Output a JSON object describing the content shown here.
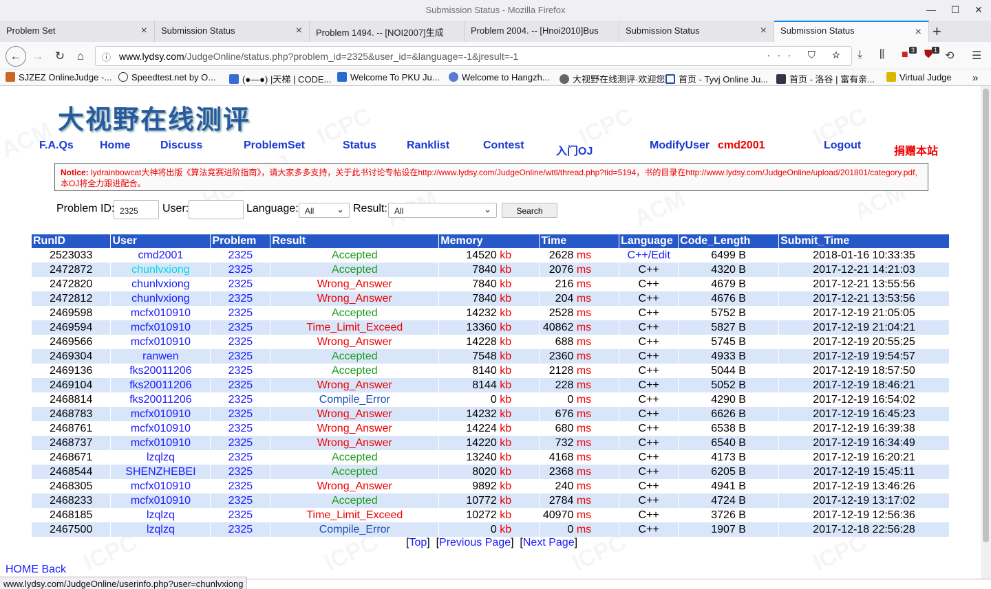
{
  "window": {
    "title": "Submission Status - Mozilla Firefox",
    "minimize": "—",
    "maximize": "☐",
    "close": "✕"
  },
  "tabs": [
    {
      "label": "Problem Set"
    },
    {
      "label": "Submission Status"
    },
    {
      "label": "Problem 1494. -- [NOI2007]生成"
    },
    {
      "label": "Problem 2004. -- [Hnoi2010]Bus"
    },
    {
      "label": "Submission Status"
    },
    {
      "label": "Submission Status"
    }
  ],
  "toolbar": {
    "url_host": "www.lydsy.com",
    "url_path": "/JudgeOnline/status.php?problem_id=2325&user_id=&language=-1&jresult=-1",
    "url_actions": "··· ⛉ ☆",
    "badge_addon1": "3",
    "badge_addon2": "1"
  },
  "bookmarks": [
    {
      "label": "SJZEZ OnlineJudge -...",
      "color": "#c62"
    },
    {
      "label": "Speedtest.net by O...",
      "color": "#333"
    },
    {
      "label": "(●—●) |天梯 | CODE...",
      "color": "#3a6bd1"
    },
    {
      "label": "Welcome To PKU Ju...",
      "color": "#2a6bd1"
    },
    {
      "label": "Welcome to Hangzh...",
      "color": "#5a7ad1"
    },
    {
      "label": "大视野在线测评·欢迎您",
      "color": "#666"
    },
    {
      "label": "首页 - Tyvj Online Ju...",
      "color": "#2a4a9a"
    },
    {
      "label": "首页 - 洛谷 | 富有亲...",
      "color": "#334"
    },
    {
      "label": "Virtual Judge",
      "color": "#d8b800"
    }
  ],
  "site": {
    "logo": "大视野在线测评",
    "menu": {
      "faqs": "F.A.Qs",
      "home": "Home",
      "discuss": "Discuss",
      "problemset": "ProblemSet",
      "status": "Status",
      "ranklist": "Ranklist",
      "contest": "Contest",
      "intro": "入门OJ",
      "modify": "ModifyUser",
      "username": "cmd2001",
      "logout": "Logout",
      "donate": "捐赠本站"
    },
    "notice": {
      "label": "Notice:",
      "text": " lydrainbowcat大神将出版《算法竞赛进阶指南》，请大家多多支持，关于此书讨论专帖设在http://www.lydsy.com/JudgeOnline/wttl/thread.php?tid=5194，书的目录在http://www.lydsy.com/JudgeOnline/upload/201801/category.pdf,本OJ将全力跟进配合。"
    }
  },
  "filters": {
    "problem_id_label": "Problem ID:",
    "problem_id_value": "2325",
    "user_label": "User:",
    "user_value": "",
    "language_label": "Language:",
    "language_value": "All",
    "result_label": "Result:",
    "result_value": "All",
    "search_button": "Search"
  },
  "table": {
    "headers": [
      "RunID",
      "User",
      "Problem",
      "Result",
      "Memory",
      "Time",
      "Language",
      "Code_Length",
      "Submit_Time"
    ],
    "mem_unit": "kb",
    "time_unit": "ms",
    "result_colors": {
      "Accepted": "#1a9b1a",
      "Wrong_Answer": "#e00",
      "Time_Limit_Exceed": "#e00",
      "Compile_Error": "#1a4fb0"
    },
    "rows": [
      {
        "run": "2523033",
        "user": "cmd2001",
        "prob": "2325",
        "res": "Accepted",
        "mem": "14520",
        "time": "2628",
        "lang": "C++/Edit",
        "code": "6499 B",
        "sub": "2018-01-16 10:33:35"
      },
      {
        "run": "2472872",
        "user": "chunlvxiong",
        "prob": "2325",
        "res": "Accepted",
        "mem": "7840",
        "time": "2076",
        "lang": "C++",
        "code": "4320 B",
        "sub": "2017-12-21 14:21:03",
        "hover": true
      },
      {
        "run": "2472820",
        "user": "chunlvxiong",
        "prob": "2325",
        "res": "Wrong_Answer",
        "mem": "7840",
        "time": "216",
        "lang": "C++",
        "code": "4679 B",
        "sub": "2017-12-21 13:55:56"
      },
      {
        "run": "2472812",
        "user": "chunlvxiong",
        "prob": "2325",
        "res": "Wrong_Answer",
        "mem": "7840",
        "time": "204",
        "lang": "C++",
        "code": "4676 B",
        "sub": "2017-12-21 13:53:56"
      },
      {
        "run": "2469598",
        "user": "mcfx010910",
        "prob": "2325",
        "res": "Accepted",
        "mem": "14232",
        "time": "2528",
        "lang": "C++",
        "code": "5752 B",
        "sub": "2017-12-19 21:05:05"
      },
      {
        "run": "2469594",
        "user": "mcfx010910",
        "prob": "2325",
        "res": "Time_Limit_Exceed",
        "mem": "13360",
        "time": "40862",
        "lang": "C++",
        "code": "5827 B",
        "sub": "2017-12-19 21:04:21"
      },
      {
        "run": "2469566",
        "user": "mcfx010910",
        "prob": "2325",
        "res": "Wrong_Answer",
        "mem": "14228",
        "time": "688",
        "lang": "C++",
        "code": "5745 B",
        "sub": "2017-12-19 20:55:25"
      },
      {
        "run": "2469304",
        "user": "ranwen",
        "prob": "2325",
        "res": "Accepted",
        "mem": "7548",
        "time": "2360",
        "lang": "C++",
        "code": "4933 B",
        "sub": "2017-12-19 19:54:57"
      },
      {
        "run": "2469136",
        "user": "fks20011206",
        "prob": "2325",
        "res": "Accepted",
        "mem": "8140",
        "time": "2128",
        "lang": "C++",
        "code": "5044 B",
        "sub": "2017-12-19 18:57:50"
      },
      {
        "run": "2469104",
        "user": "fks20011206",
        "prob": "2325",
        "res": "Wrong_Answer",
        "mem": "8144",
        "time": "228",
        "lang": "C++",
        "code": "5052 B",
        "sub": "2017-12-19 18:46:21"
      },
      {
        "run": "2468814",
        "user": "fks20011206",
        "prob": "2325",
        "res": "Compile_Error",
        "mem": "0",
        "time": "0",
        "lang": "C++",
        "code": "4290 B",
        "sub": "2017-12-19 16:54:02"
      },
      {
        "run": "2468783",
        "user": "mcfx010910",
        "prob": "2325",
        "res": "Wrong_Answer",
        "mem": "14232",
        "time": "676",
        "lang": "C++",
        "code": "6626 B",
        "sub": "2017-12-19 16:45:23"
      },
      {
        "run": "2468761",
        "user": "mcfx010910",
        "prob": "2325",
        "res": "Wrong_Answer",
        "mem": "14224",
        "time": "680",
        "lang": "C++",
        "code": "6538 B",
        "sub": "2017-12-19 16:39:38"
      },
      {
        "run": "2468737",
        "user": "mcfx010910",
        "prob": "2325",
        "res": "Wrong_Answer",
        "mem": "14220",
        "time": "732",
        "lang": "C++",
        "code": "6540 B",
        "sub": "2017-12-19 16:34:49"
      },
      {
        "run": "2468671",
        "user": "lzqlzq",
        "prob": "2325",
        "res": "Accepted",
        "mem": "13240",
        "time": "4168",
        "lang": "C++",
        "code": "4173 B",
        "sub": "2017-12-19 16:20:21"
      },
      {
        "run": "2468544",
        "user": "SHENZHEBEI",
        "prob": "2325",
        "res": "Accepted",
        "mem": "8020",
        "time": "2368",
        "lang": "C++",
        "code": "6205 B",
        "sub": "2017-12-19 15:45:11"
      },
      {
        "run": "2468305",
        "user": "mcfx010910",
        "prob": "2325",
        "res": "Wrong_Answer",
        "mem": "9892",
        "time": "240",
        "lang": "C++",
        "code": "4941 B",
        "sub": "2017-12-19 13:46:26"
      },
      {
        "run": "2468233",
        "user": "mcfx010910",
        "prob": "2325",
        "res": "Accepted",
        "mem": "10772",
        "time": "2784",
        "lang": "C++",
        "code": "4724 B",
        "sub": "2017-12-19 13:17:02"
      },
      {
        "run": "2468185",
        "user": "lzqlzq",
        "prob": "2325",
        "res": "Time_Limit_Exceed",
        "mem": "10272",
        "time": "40970",
        "lang": "C++",
        "code": "3726 B",
        "sub": "2017-12-19 12:56:36"
      },
      {
        "run": "2467500",
        "user": "lzqlzq",
        "prob": "2325",
        "res": "Compile_Error",
        "mem": "0",
        "time": "0",
        "lang": "C++",
        "code": "1907 B",
        "sub": "2017-12-18 22:56:28"
      }
    ]
  },
  "pager": {
    "top": "Top",
    "prev": "Previous Page",
    "next": "Next Page"
  },
  "footer": {
    "home_back": "HOME Back",
    "status_url": "www.lydsy.com/JudgeOnline/userinfo.php?user=chunlvxiong"
  }
}
